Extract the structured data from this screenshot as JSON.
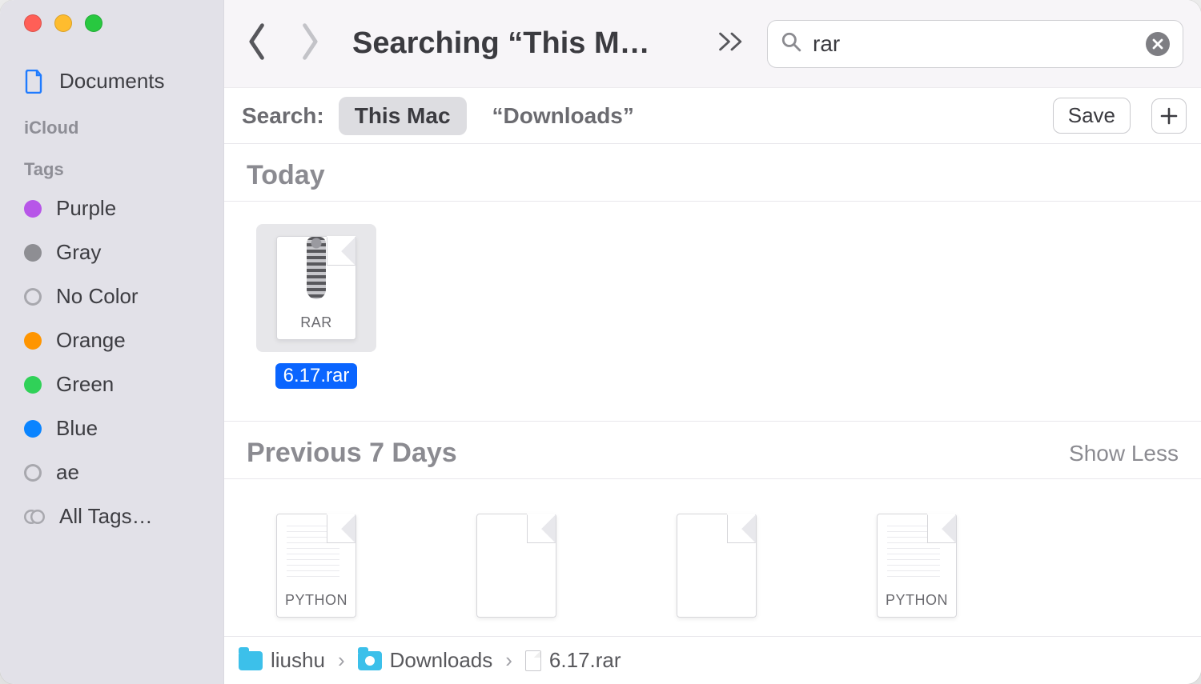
{
  "window": {
    "title": "Searching “This M…"
  },
  "sidebar": {
    "favorites": [
      {
        "label": "Documents",
        "type": "documents"
      }
    ],
    "icloud_heading": "iCloud",
    "tags_heading": "Tags",
    "tags": [
      {
        "label": "Purple",
        "color": "#b756e8",
        "hollow": false
      },
      {
        "label": "Gray",
        "color": "#8e8e93",
        "hollow": false
      },
      {
        "label": "No Color",
        "color": "",
        "hollow": true
      },
      {
        "label": "Orange",
        "color": "#ff9500",
        "hollow": false
      },
      {
        "label": "Green",
        "color": "#30d158",
        "hollow": false
      },
      {
        "label": "Blue",
        "color": "#0a84ff",
        "hollow": false
      },
      {
        "label": "ae",
        "color": "",
        "hollow": true
      }
    ],
    "all_tags_label": "All Tags…"
  },
  "search": {
    "value": "rar"
  },
  "scope": {
    "label": "Search:",
    "scopes": [
      {
        "label": "This Mac",
        "active": true
      },
      {
        "label": "“Downloads”",
        "active": false
      }
    ],
    "save_label": "Save"
  },
  "sections": [
    {
      "title": "Today",
      "show_less": null,
      "items": [
        {
          "name": "6.17.rar",
          "kind": "rar",
          "caption": "RAR",
          "selected": true
        }
      ]
    },
    {
      "title": "Previous 7 Days",
      "show_less": "Show Less",
      "items": [
        {
          "name": "",
          "kind": "python",
          "caption": "PYTHON",
          "selected": false
        },
        {
          "name": "",
          "kind": "blank",
          "caption": "",
          "selected": false
        },
        {
          "name": "",
          "kind": "blank",
          "caption": "",
          "selected": false
        },
        {
          "name": "",
          "kind": "python",
          "caption": "PYTHON",
          "selected": false
        }
      ]
    }
  ],
  "path": [
    {
      "label": "liushu",
      "icon": "home-folder"
    },
    {
      "label": "Downloads",
      "icon": "dl-folder"
    },
    {
      "label": "6.17.rar",
      "icon": "doc"
    }
  ]
}
